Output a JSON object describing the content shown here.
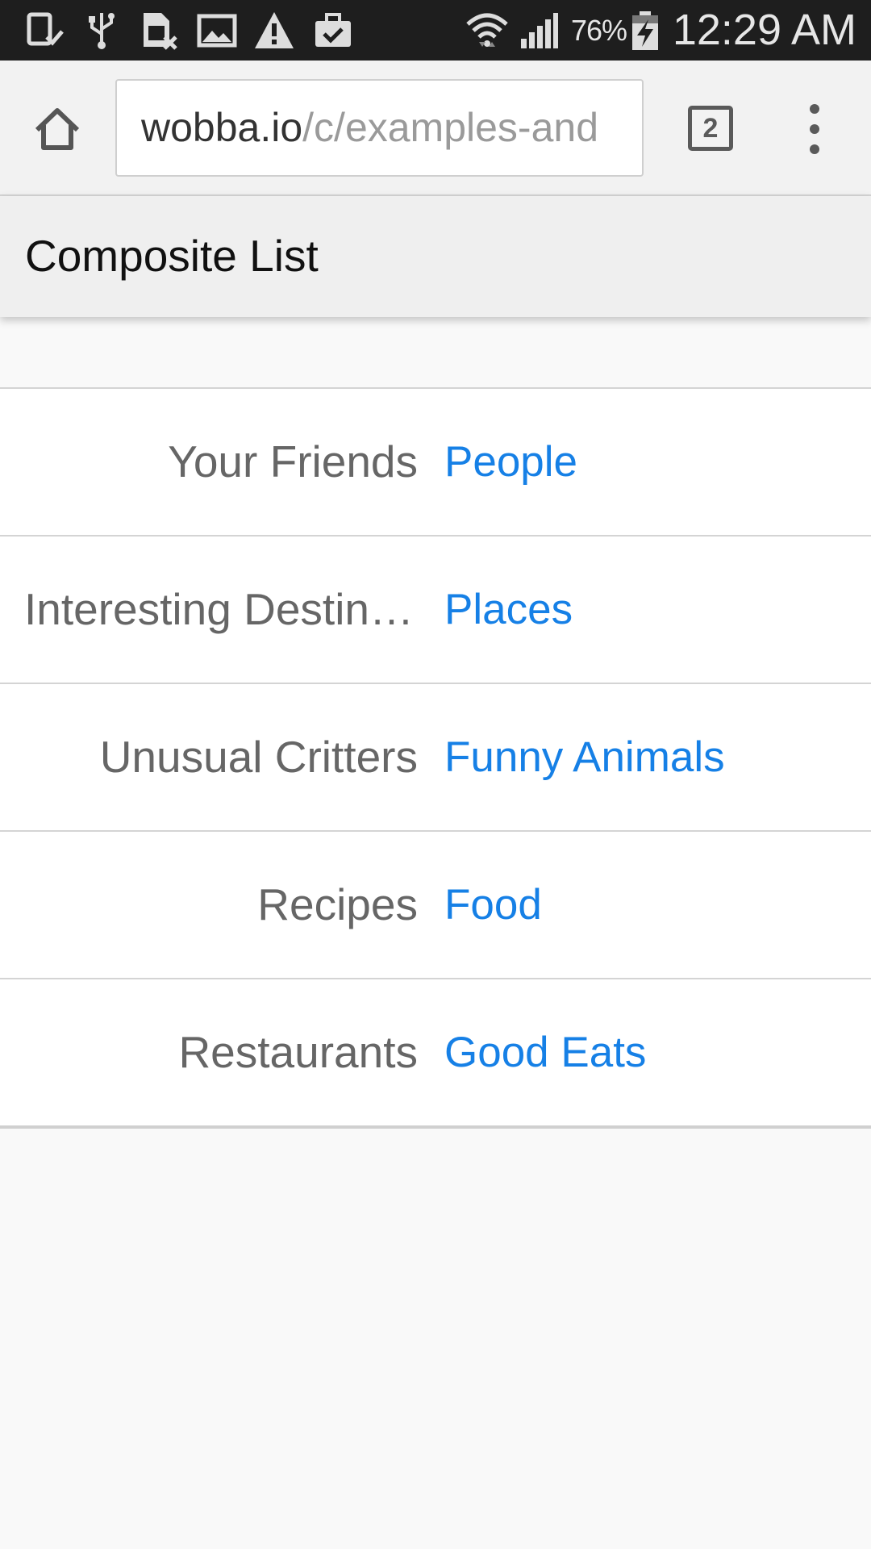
{
  "status_bar": {
    "icons": [
      "phone-check-icon",
      "usb-icon",
      "sim-error-icon",
      "image-icon",
      "warning-icon",
      "briefcase-check-icon",
      "wifi-icon",
      "signal-icon",
      "battery-charging-icon"
    ],
    "battery_percent": "76%",
    "battery_level": 0.76,
    "time": "12:29 AM"
  },
  "browser": {
    "url_host": "wobba.io",
    "url_path": "/c/examples-and",
    "tab_count": "2",
    "icons": [
      "home-icon",
      "tabs-icon",
      "overflow-menu-icon"
    ]
  },
  "app": {
    "title": "Composite List"
  },
  "list": {
    "items": [
      {
        "label": "Your Friends",
        "value": "People"
      },
      {
        "label": "Interesting Destinations",
        "value": "Places"
      },
      {
        "label": "Unusual Critters",
        "value": "Funny Animals"
      },
      {
        "label": "Recipes",
        "value": "Food"
      },
      {
        "label": "Restaurants",
        "value": "Good Eats"
      }
    ]
  },
  "colors": {
    "status_bar_bg": "#1e1e1e",
    "toolbar_bg": "#f2f2f2",
    "header_bg": "#efefef",
    "link_blue": "#1680e6",
    "label_gray": "#666666",
    "page_bg": "#f9f9f9"
  }
}
